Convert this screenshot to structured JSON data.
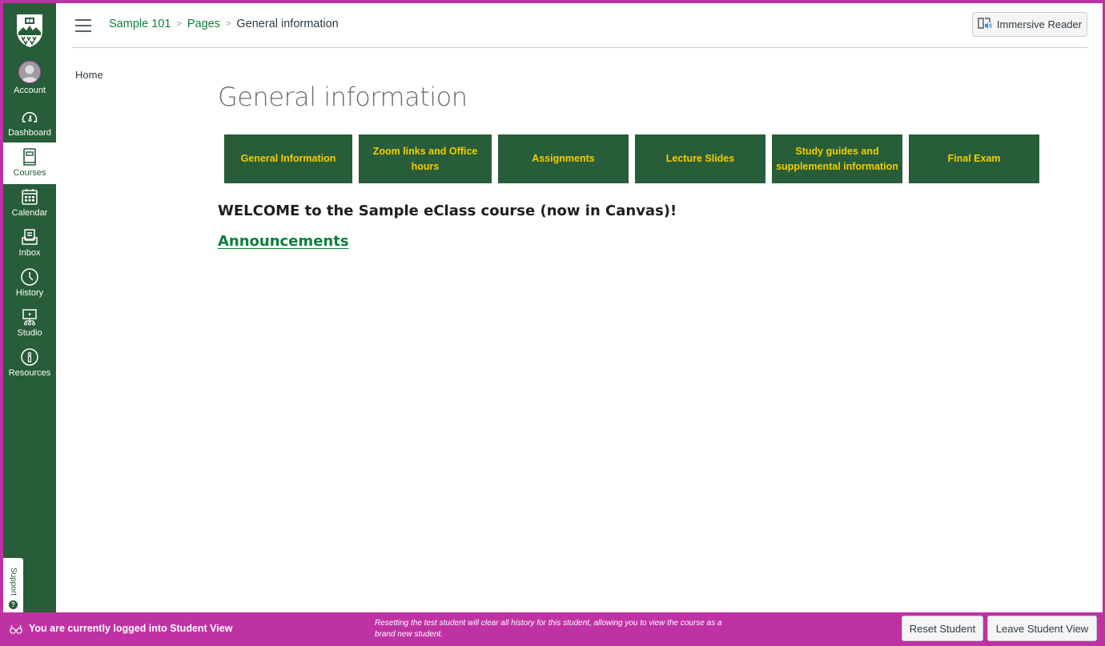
{
  "global_nav": {
    "items": [
      {
        "label": "Account",
        "icon": "avatar-icon"
      },
      {
        "label": "Dashboard",
        "icon": "dashboard-icon"
      },
      {
        "label": "Courses",
        "icon": "courses-icon",
        "active": true
      },
      {
        "label": "Calendar",
        "icon": "calendar-icon"
      },
      {
        "label": "Inbox",
        "icon": "inbox-icon"
      },
      {
        "label": "History",
        "icon": "history-icon"
      },
      {
        "label": "Studio",
        "icon": "studio-icon"
      },
      {
        "label": "Resources",
        "icon": "resources-icon"
      }
    ],
    "support_label": "Support",
    "support_icon": "?"
  },
  "header": {
    "breadcrumb": [
      {
        "label": "Sample 101",
        "link": true
      },
      {
        "label": "Pages",
        "link": true
      },
      {
        "label": "General information",
        "link": false
      }
    ],
    "immersive_reader_label": "Immersive Reader"
  },
  "course_nav": {
    "items": [
      {
        "label": "Home"
      }
    ]
  },
  "page": {
    "title": "General information",
    "tiles": [
      {
        "label": "General Information"
      },
      {
        "label": "Zoom links and Office hours"
      },
      {
        "label": "Assignments"
      },
      {
        "label": "Lecture Slides"
      },
      {
        "label": "Study guides and supplemental information"
      },
      {
        "label": "Final Exam"
      }
    ],
    "welcome_text": "WELCOME to the Sample eClass course (now in Canvas)!",
    "announcements_link": "Announcements"
  },
  "student_view": {
    "message": "You are currently logged into Student View",
    "note": "Resetting the test student will clear all history for this student, allowing you to view the course as a brand new student.",
    "reset_label": "Reset Student",
    "leave_label": "Leave Student View"
  },
  "colors": {
    "nav_green": "#275d38",
    "tile_text_gold": "#f2cd00",
    "link_green": "#0e7e3d",
    "student_view_magenta": "#bf32a4"
  }
}
